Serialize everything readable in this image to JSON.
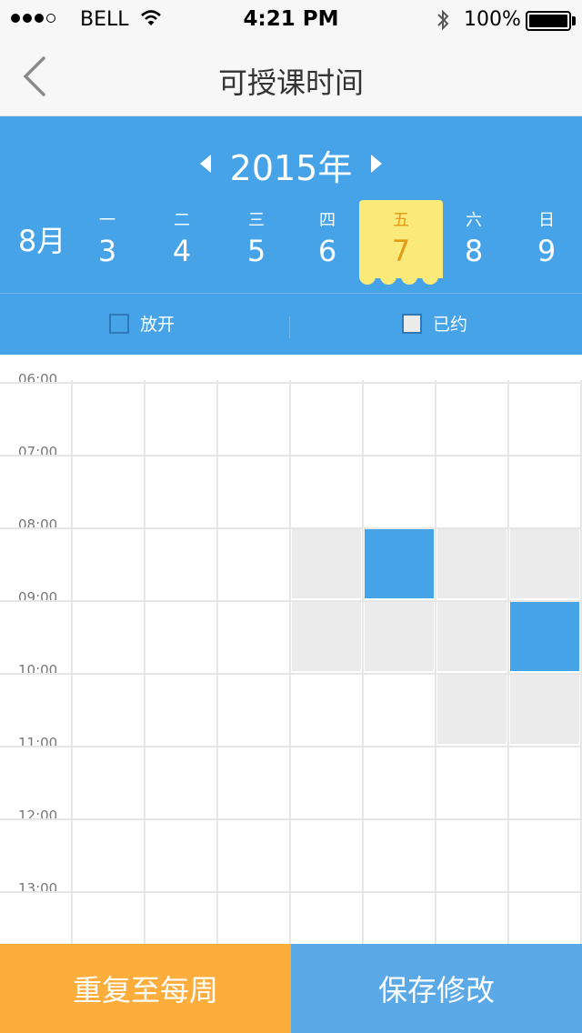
{
  "status_bar": {
    "carrier": "BELL",
    "time": "4:21 PM",
    "battery": "100%"
  },
  "nav": {
    "title": "可授课时间"
  },
  "calendar": {
    "year_label": "2015年",
    "month_label": "8月",
    "days": [
      {
        "weekday": "一",
        "date": "3"
      },
      {
        "weekday": "二",
        "date": "4"
      },
      {
        "weekday": "三",
        "date": "5"
      },
      {
        "weekday": "四",
        "date": "6"
      },
      {
        "weekday": "五",
        "date": "7",
        "selected": true
      },
      {
        "weekday": "六",
        "date": "8"
      },
      {
        "weekday": "日",
        "date": "9"
      }
    ],
    "legend": {
      "open": "放开",
      "booked": "已约"
    }
  },
  "schedule": {
    "times": [
      "06:00",
      "07:00",
      "08:00",
      "09:00",
      "10:00",
      "11:00",
      "12:00",
      "13:00"
    ],
    "cells": [
      {
        "day": 3,
        "hour": 2,
        "state": "booked"
      },
      {
        "day": 4,
        "hour": 2,
        "state": "open"
      },
      {
        "day": 5,
        "hour": 2,
        "state": "booked"
      },
      {
        "day": 6,
        "hour": 2,
        "state": "booked"
      },
      {
        "day": 3,
        "hour": 3,
        "state": "booked"
      },
      {
        "day": 4,
        "hour": 3,
        "state": "booked"
      },
      {
        "day": 5,
        "hour": 3,
        "state": "booked"
      },
      {
        "day": 6,
        "hour": 3,
        "state": "open"
      },
      {
        "day": 5,
        "hour": 4,
        "state": "booked"
      },
      {
        "day": 6,
        "hour": 4,
        "state": "booked"
      }
    ]
  },
  "colors": {
    "primary_blue": "#47a3e8",
    "selected_day": "#fbe97a",
    "booked_gray": "#ebebeb",
    "repeat_orange": "#fcad3b",
    "save_blue": "#5aa9e6"
  },
  "actions": {
    "repeat_label": "重复至每周",
    "save_label": "保存修改"
  }
}
